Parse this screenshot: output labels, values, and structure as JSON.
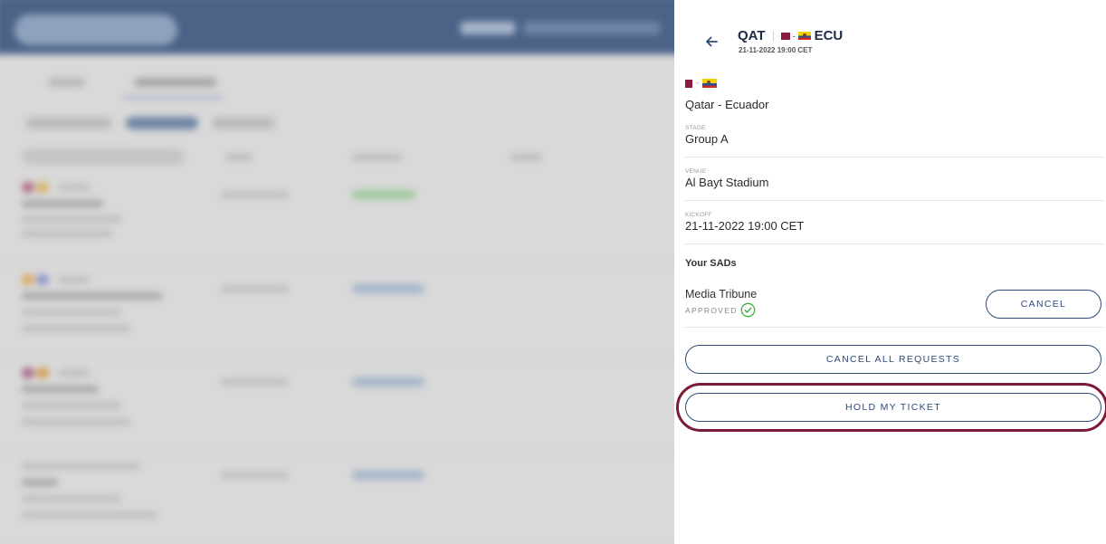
{
  "colors": {
    "primary": "#2e4a78",
    "highlight": "#7d1a36",
    "success": "#3fae3f",
    "background_header": "#4a6387"
  },
  "icons": {
    "back": "arrow-left-icon",
    "approved": "check-circle-icon"
  },
  "header": {
    "home_code": "QAT",
    "away_code": "ECU",
    "datetime": "21-11-2022 19:00 CET"
  },
  "match": {
    "name": "Qatar - Ecuador",
    "stage": {
      "label": "STAGE",
      "value": "Group A"
    },
    "venue": {
      "label": "VENUE",
      "value": "Al Bayt Stadium"
    },
    "kickoff": {
      "label": "KICKOFF",
      "value": "21-11-2022 19:00 CET"
    }
  },
  "sads": {
    "heading": "Your SADs",
    "items": [
      {
        "name": "Media Tribune",
        "status": "APPROVED",
        "action": "CANCEL"
      }
    ]
  },
  "actions": {
    "cancel_all": "CANCEL ALL REQUESTS",
    "hold_ticket": "HOLD MY TICKET"
  }
}
